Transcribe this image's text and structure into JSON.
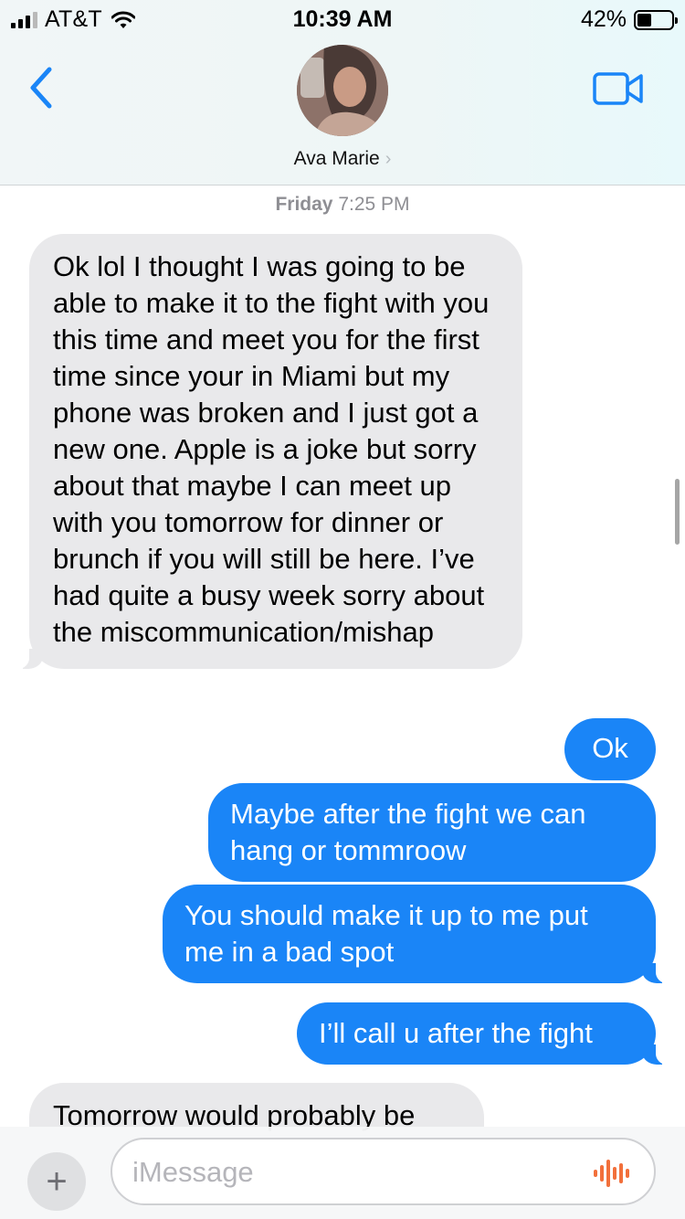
{
  "status_bar": {
    "carrier": "AT&T",
    "time": "10:39 AM",
    "battery_percent": "42%",
    "battery_level": 0.42,
    "signal_bars_active": 3,
    "signal_bars_total": 4
  },
  "header": {
    "contact_name": "Ava Marie",
    "name_chevron": "›",
    "icons": [
      "back-chevron-icon",
      "video-camera-icon"
    ]
  },
  "chat": {
    "timestamp_day": "Friday",
    "timestamp_time": "7:25 PM",
    "messages": [
      {
        "direction": "incoming",
        "text": "Ok lol I thought I was going to be able to make it to the fight with you this time and meet you for the first time since your in Miami but my phone was broken and I just got a new one. Apple is a joke but sorry about that maybe I can meet up with you tomorrow for dinner or brunch if you will still be here. I’ve had quite a busy week sorry about the miscommunication/mishap"
      },
      {
        "direction": "outgoing",
        "text": "Ok"
      },
      {
        "direction": "outgoing",
        "text": "Maybe after the fight we can hang or tommroow"
      },
      {
        "direction": "outgoing",
        "text": "You should make it up to me put me in a bad spot"
      },
      {
        "direction": "outgoing",
        "text": "I’ll call u after the fight"
      },
      {
        "direction": "incoming",
        "text": "Tomorrow would probably be"
      }
    ]
  },
  "input_bar": {
    "plus_label": "+",
    "placeholder": "iMessage",
    "audio_icon": "audio-waveform-icon"
  },
  "colors": {
    "outgoing_bubble": "#1a85f7",
    "incoming_bubble": "#e9e9eb",
    "accent": "#1a85f7",
    "audio_icon": "#f2703b"
  }
}
